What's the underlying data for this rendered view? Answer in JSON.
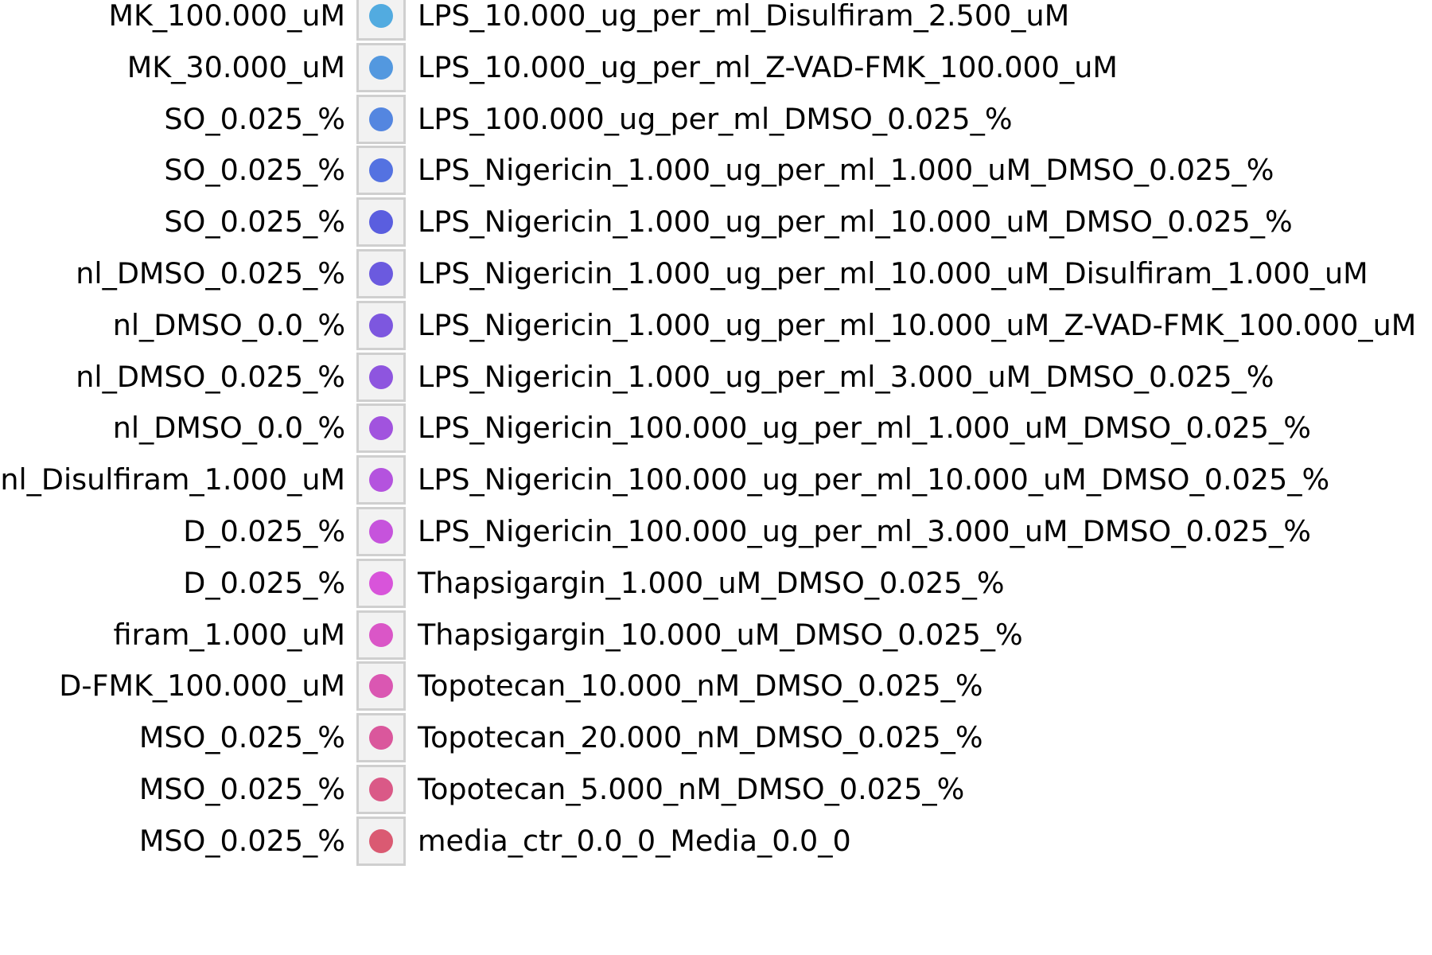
{
  "chart_data": {
    "type": "scatter",
    "legend_placement": "right",
    "legend_left_column": [
      "MK_100.000_uM",
      "MK_30.000_uM",
      "SO_0.025_%",
      "SO_0.025_%",
      "SO_0.025_%",
      "nl_DMSO_0.025_%",
      "nl_DMSO_0.0_%",
      "nl_DMSO_0.025_%",
      "nl_DMSO_0.0_%",
      "nl_Disulfiram_1.000_uM",
      "D_0.025_%",
      "D_0.025_%",
      "firam_1.000_uM",
      "D-FMK_100.000_uM",
      "MSO_0.025_%",
      "MSO_0.025_%",
      "MSO_0.025_%"
    ],
    "series": [
      {
        "name": "LPS_10.000_ug_per_ml_Disulfiram_2.500_uM",
        "color": "#52abe0"
      },
      {
        "name": "LPS_10.000_ug_per_ml_Z-VAD-FMK_100.000_uM",
        "color": "#5398df"
      },
      {
        "name": "LPS_100.000_ug_per_ml_DMSO_0.025_%",
        "color": "#5486e0"
      },
      {
        "name": "LPS_Nigericin_1.000_ug_per_ml_1.000_uM_DMSO_0.025_%",
        "color": "#5472e1"
      },
      {
        "name": "LPS_Nigericin_1.000_ug_per_ml_10.000_uM_DMSO_0.025_%",
        "color": "#5a5edf"
      },
      {
        "name": "LPS_Nigericin_1.000_ug_per_ml_10.000_uM_Disulfiram_1.000_uM",
        "color": "#6b5adf"
      },
      {
        "name": "LPS_Nigericin_1.000_ug_per_ml_10.000_uM_Z-VAD-FMK_100.000_uM",
        "color": "#7d57df"
      },
      {
        "name": "LPS_Nigericin_1.000_ug_per_ml_3.000_uM_DMSO_0.025_%",
        "color": "#8e55df"
      },
      {
        "name": "LPS_Nigericin_100.000_ug_per_ml_1.000_uM_DMSO_0.025_%",
        "color": "#a153de"
      },
      {
        "name": "LPS_Nigericin_100.000_ug_per_ml_10.000_uM_DMSO_0.025_%",
        "color": "#b453de"
      },
      {
        "name": "LPS_Nigericin_100.000_ug_per_ml_3.000_uM_DMSO_0.025_%",
        "color": "#c653dc"
      },
      {
        "name": "Thapsigargin_1.000_uM_DMSO_0.025_%",
        "color": "#d854da"
      },
      {
        "name": "Thapsigargin_10.000_uM_DMSO_0.025_%",
        "color": "#da56c7"
      },
      {
        "name": "Topotecan_10.000_nM_DMSO_0.025_%",
        "color": "#da57b2"
      },
      {
        "name": "Topotecan_20.000_nM_DMSO_0.025_%",
        "color": "#da579c"
      },
      {
        "name": "Topotecan_5.000_nM_DMSO_0.025_%",
        "color": "#da5987"
      },
      {
        "name": "media_ctr_0.0_0_Media_0.0_0",
        "color": "#da5a72"
      }
    ]
  }
}
